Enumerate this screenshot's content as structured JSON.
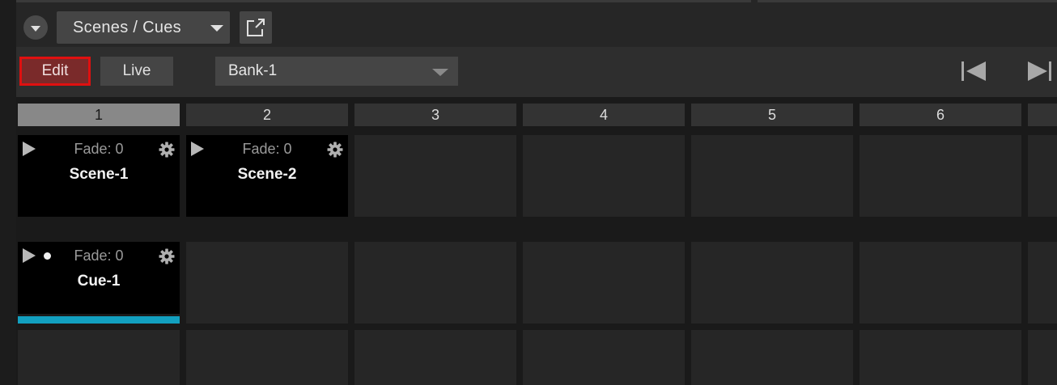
{
  "header": {
    "view_selector": "Scenes / Cues"
  },
  "toolbar": {
    "edit_label": "Edit",
    "live_label": "Live",
    "bank": "Bank-1"
  },
  "columns": [
    "1",
    "2",
    "3",
    "4",
    "5",
    "6"
  ],
  "active_column": "1",
  "scenes": [
    {
      "name": "Scene-1",
      "fade": "Fade: 0"
    },
    {
      "name": "Scene-2",
      "fade": "Fade: 0"
    }
  ],
  "cues": [
    {
      "name": "Cue-1",
      "fade": "Fade: 0"
    }
  ],
  "colors": {
    "edit_border": "#e01010",
    "edit_fill": "#7a2a2a",
    "cue_bar": "#12a0c0"
  }
}
